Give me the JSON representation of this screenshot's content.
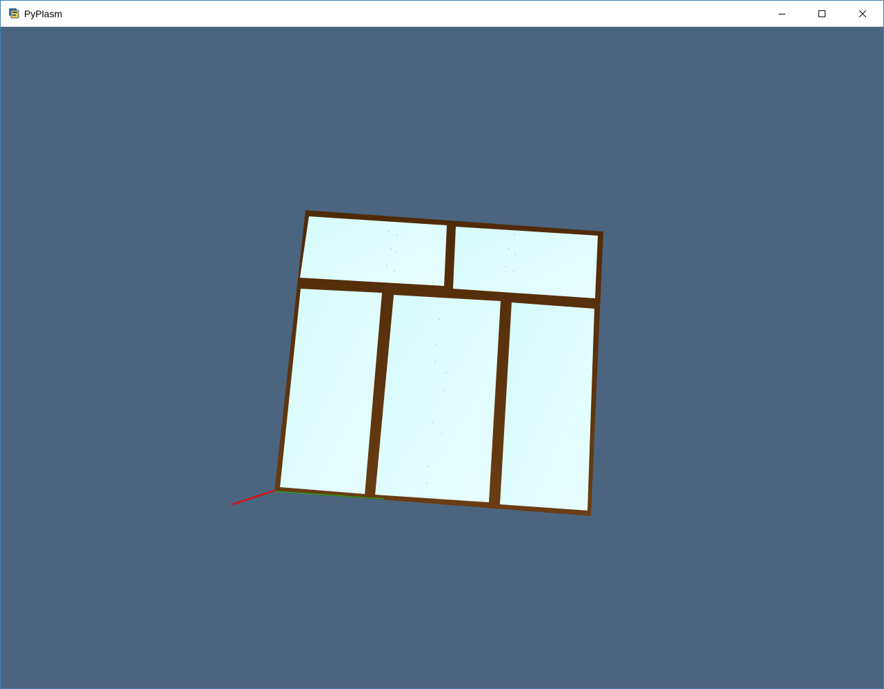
{
  "window": {
    "title": "PyPlasm",
    "background_color": "#4b6580",
    "controls": {
      "minimize_icon": "minimize-icon",
      "maximize_icon": "maximize-icon",
      "close_icon": "close-icon"
    }
  },
  "scene": {
    "frame_color": "#5a3510",
    "glass_color": "#dcfcfc",
    "axis_x_color": "#e01010",
    "axis_y_color": "#10c010"
  }
}
